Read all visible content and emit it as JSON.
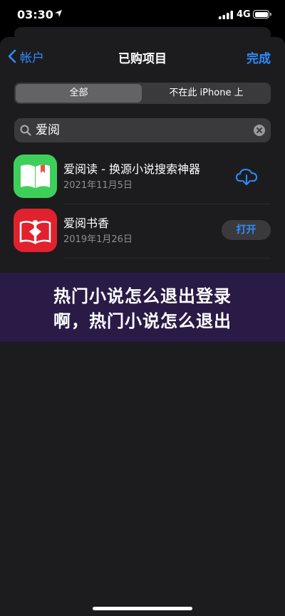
{
  "status_bar": {
    "time": "03:30",
    "network": "4G"
  },
  "nav": {
    "back_label": "帐户",
    "title": "已购项目",
    "done_label": "完成"
  },
  "segments": [
    "全部",
    "不在此 iPhone 上"
  ],
  "search": {
    "value": "爱阅"
  },
  "apps": [
    {
      "name": "爱阅读 - 换源小说搜索神器",
      "date": "2021年11月5日",
      "action": "download"
    },
    {
      "name": "爱阅书香",
      "date": "2019年1月26日",
      "action_label": "打开"
    }
  ],
  "banner": {
    "line1": "热门小说怎么退出登录",
    "line2": "啊，热门小说怎么退出"
  },
  "colors": {
    "accent": "#2f8cff",
    "app1_icon": "#3ecf5a",
    "app2_icon": "#e2212f",
    "banner_bg": "#2a1a46"
  }
}
